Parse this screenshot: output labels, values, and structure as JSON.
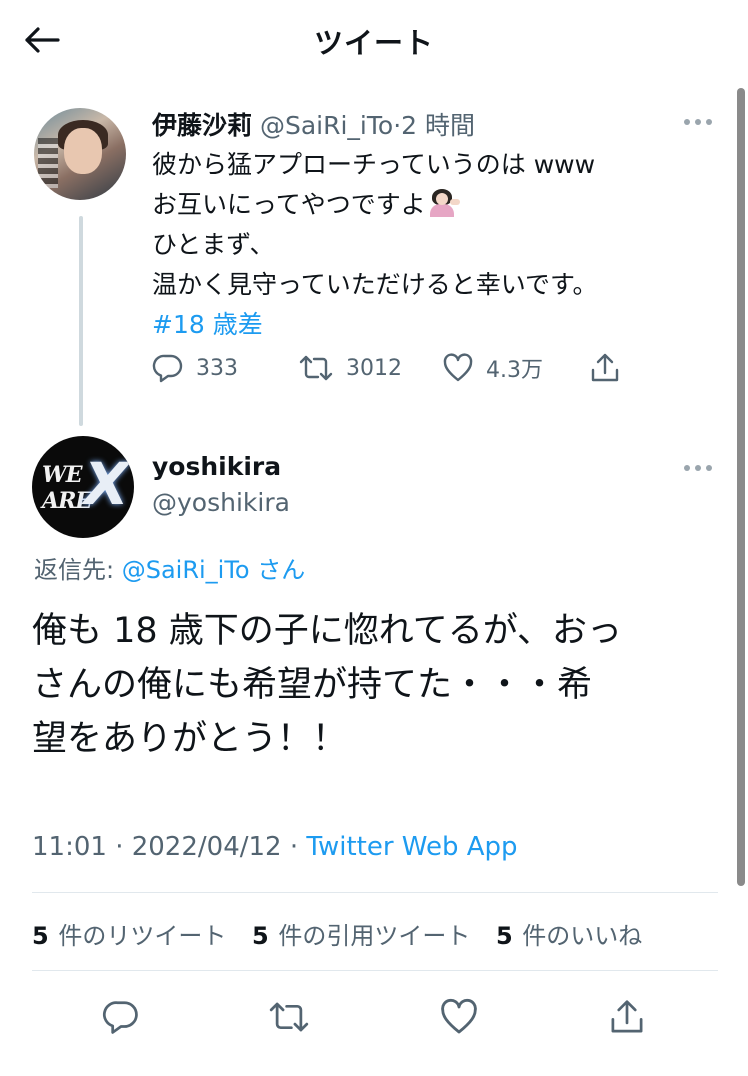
{
  "header": {
    "title": "ツイート"
  },
  "parent_tweet": {
    "name": "伊藤沙莉",
    "handle": "@SaiRi_iTo",
    "separator": "·",
    "time": "2 時間",
    "lines": [
      "彼から猛アプローチっていうのは www",
      "お互いにってやつですよ",
      "ひとまず、",
      "温かく見守っていただけると幸いです。"
    ],
    "emoji": "person-tipping-hand-emoji",
    "hashtag": "#18 歳差",
    "replies": "333",
    "retweets": "3012",
    "likes": "4.3万"
  },
  "reply_tweet": {
    "name": "yoshikira",
    "handle": "@yoshikira",
    "avatar_logo": {
      "text": "WE ARE",
      "mark": "X"
    },
    "replying_label": "返信先: ",
    "replying_mention": "@SaiRi_iTo",
    "replying_suffix": " さん",
    "lines": [
      "俺も 18 歳下の子に惚れてるが、おっ",
      "さんの俺にも希望が持てた・・・希",
      "望をありがとう！！"
    ],
    "time": "11:01 · 2022/04/12 · ",
    "app": "Twitter Web App",
    "stats": {
      "retweets_count": "5",
      "retweets_label": " 件のリツイート",
      "quotes_count": "5",
      "quotes_label": " 件の引用ツイート",
      "likes_count": "5",
      "likes_label": " 件のいいね"
    }
  },
  "colors": {
    "accent": "#1d9bf0",
    "secondary_text": "#536471",
    "primary_text": "#0f1419"
  }
}
